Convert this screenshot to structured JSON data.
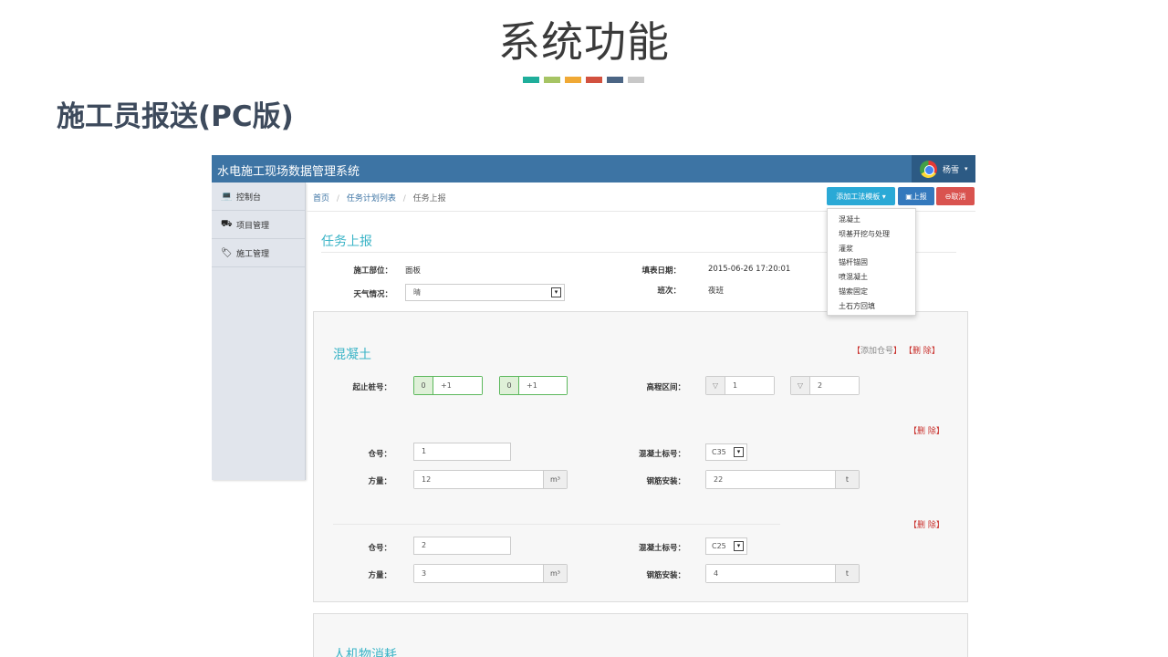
{
  "slide": {
    "title": "系统功能",
    "subtitle": "施工员报送(PC版)",
    "bar_colors": [
      "#1fae9b",
      "#a6c464",
      "#f0a935",
      "#d2513f",
      "#4b6584",
      "#c8c8c8"
    ]
  },
  "app": {
    "brand": "水电施工现场数据管理系统",
    "user": {
      "name": "杨雪",
      "caret": "▾"
    },
    "sidebar": [
      {
        "icon": "laptop-icon",
        "glyph": "💻",
        "label": "控制台"
      },
      {
        "icon": "road-icon",
        "glyph": "⛟",
        "label": "项目管理"
      },
      {
        "icon": "tags-icon",
        "glyph": "🏷",
        "label": "施工管理"
      }
    ],
    "breadcrumb": {
      "home": "首页",
      "list": "任务计划列表",
      "current": "任务上报",
      "sep": "/"
    },
    "toolbar": {
      "add_template": "添加工法模板 ▾",
      "report": "▣上报",
      "cancel": "⊖取消"
    },
    "template_menu": [
      "混凝土",
      "坝基开挖与处理",
      "灌浆",
      "锚杆锚固",
      "喷混凝土",
      "锚索固定",
      "土石方回填"
    ],
    "task": {
      "title": "任务上报",
      "part_label": "施工部位：",
      "part_value": "面板",
      "date_label": "填表日期：",
      "date_value": "2015-06-26 17:20:01",
      "weather_label": "天气情况：",
      "weather_value": "晴",
      "shift_label": "班次：",
      "shift_value": "夜班",
      "select_arrow": "▾"
    },
    "concrete": {
      "title": "混凝土",
      "add_bracket_open": "【",
      "add_link": "添加仓号",
      "bracket_close": "】",
      "delete_link": "删 除",
      "station_label": "起止桩号：",
      "station_from": {
        "prefix": "0",
        "value": "+1"
      },
      "station_to": {
        "prefix": "0",
        "value": "+1"
      },
      "elev_label": "高程区间：",
      "elev_from": {
        "prefix": "▽",
        "value": "1"
      },
      "elev_to": {
        "prefix": "▽",
        "value": "2"
      },
      "blocks": [
        {
          "delete": "删 除",
          "cang_label": "仓号：",
          "cang_value": "1",
          "grade_label": "混凝土标号：",
          "grade_value": "C35",
          "volume_label": "方量：",
          "volume_value": "12",
          "volume_unit": "m³",
          "rebar_label": "钢筋安装：",
          "rebar_value": "22",
          "rebar_unit": "t"
        },
        {
          "delete": "删 除",
          "cang_label": "仓号：",
          "cang_value": "2",
          "grade_label": "混凝土标号：",
          "grade_value": "C25",
          "volume_label": "方量：",
          "volume_value": "3",
          "volume_unit": "m³",
          "rebar_label": "钢筋安装：",
          "rebar_value": "4",
          "rebar_unit": "t"
        }
      ]
    },
    "resources": {
      "title": "人机物消耗"
    }
  }
}
